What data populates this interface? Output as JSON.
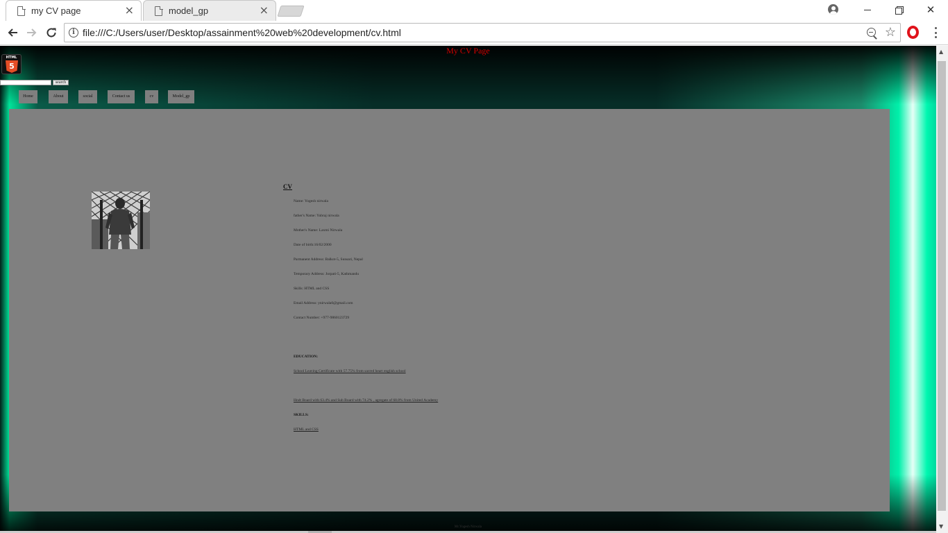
{
  "browser": {
    "tabs": [
      {
        "title": "my CV page",
        "active": true
      },
      {
        "title": "model_gp",
        "active": false
      }
    ],
    "address_url": "file:///C:/Users/user/Desktop/assainment%20web%20development/cv.html",
    "icons": [
      "page-icon",
      "close-icon",
      "back-icon",
      "forward-icon",
      "reload-icon",
      "info-icon",
      "zoom-icon",
      "star-icon",
      "opera-icon",
      "menu-icon",
      "account-icon"
    ],
    "window_controls": {
      "minimize": "–",
      "restore": "",
      "close": "✕"
    }
  },
  "page": {
    "heading": "My CV Page",
    "logo_text": "HTML",
    "logo_glyph": "5",
    "search": {
      "value": "",
      "button_label": "search"
    },
    "nav": [
      "Home",
      "About",
      "social",
      "Contact us",
      "cv",
      "Model_gp"
    ],
    "cv": {
      "heading": "CV",
      "details": [
        "Name: Yogesh nirwala",
        "father's Name: Yubraj nirwala",
        "Mother's Name: Laxmi Nirwala",
        "Date of birth:16/02/2000",
        "Parmanent Address: Balkot-5, Sunsari, Nepal",
        "Temporary Address: Jorpati-5, Kathmandu",
        "Skills: HTML and CSS",
        "Email Address: ynirwala0@gmail.com",
        "Contact Number: +977-9860123729"
      ],
      "education_heading": "EDUCATION:",
      "education": [
        "School Leaving Certificate with 57.75% from sacred heart english school",
        "Hndt Board with 63.4% and Sub Board with 74.2% , agregate of 68.8% from United Academy"
      ],
      "skills_heading": "SKILLS:",
      "skills": [
        "HTML and CSS"
      ]
    },
    "footer": "Mr.Yogesh Nirwala",
    "colors": {
      "heading": "#d40000",
      "panel": "#808080",
      "nav_button": "#7f7f7f",
      "accent_green": "#00e49a",
      "html5": "#e44d26"
    }
  }
}
